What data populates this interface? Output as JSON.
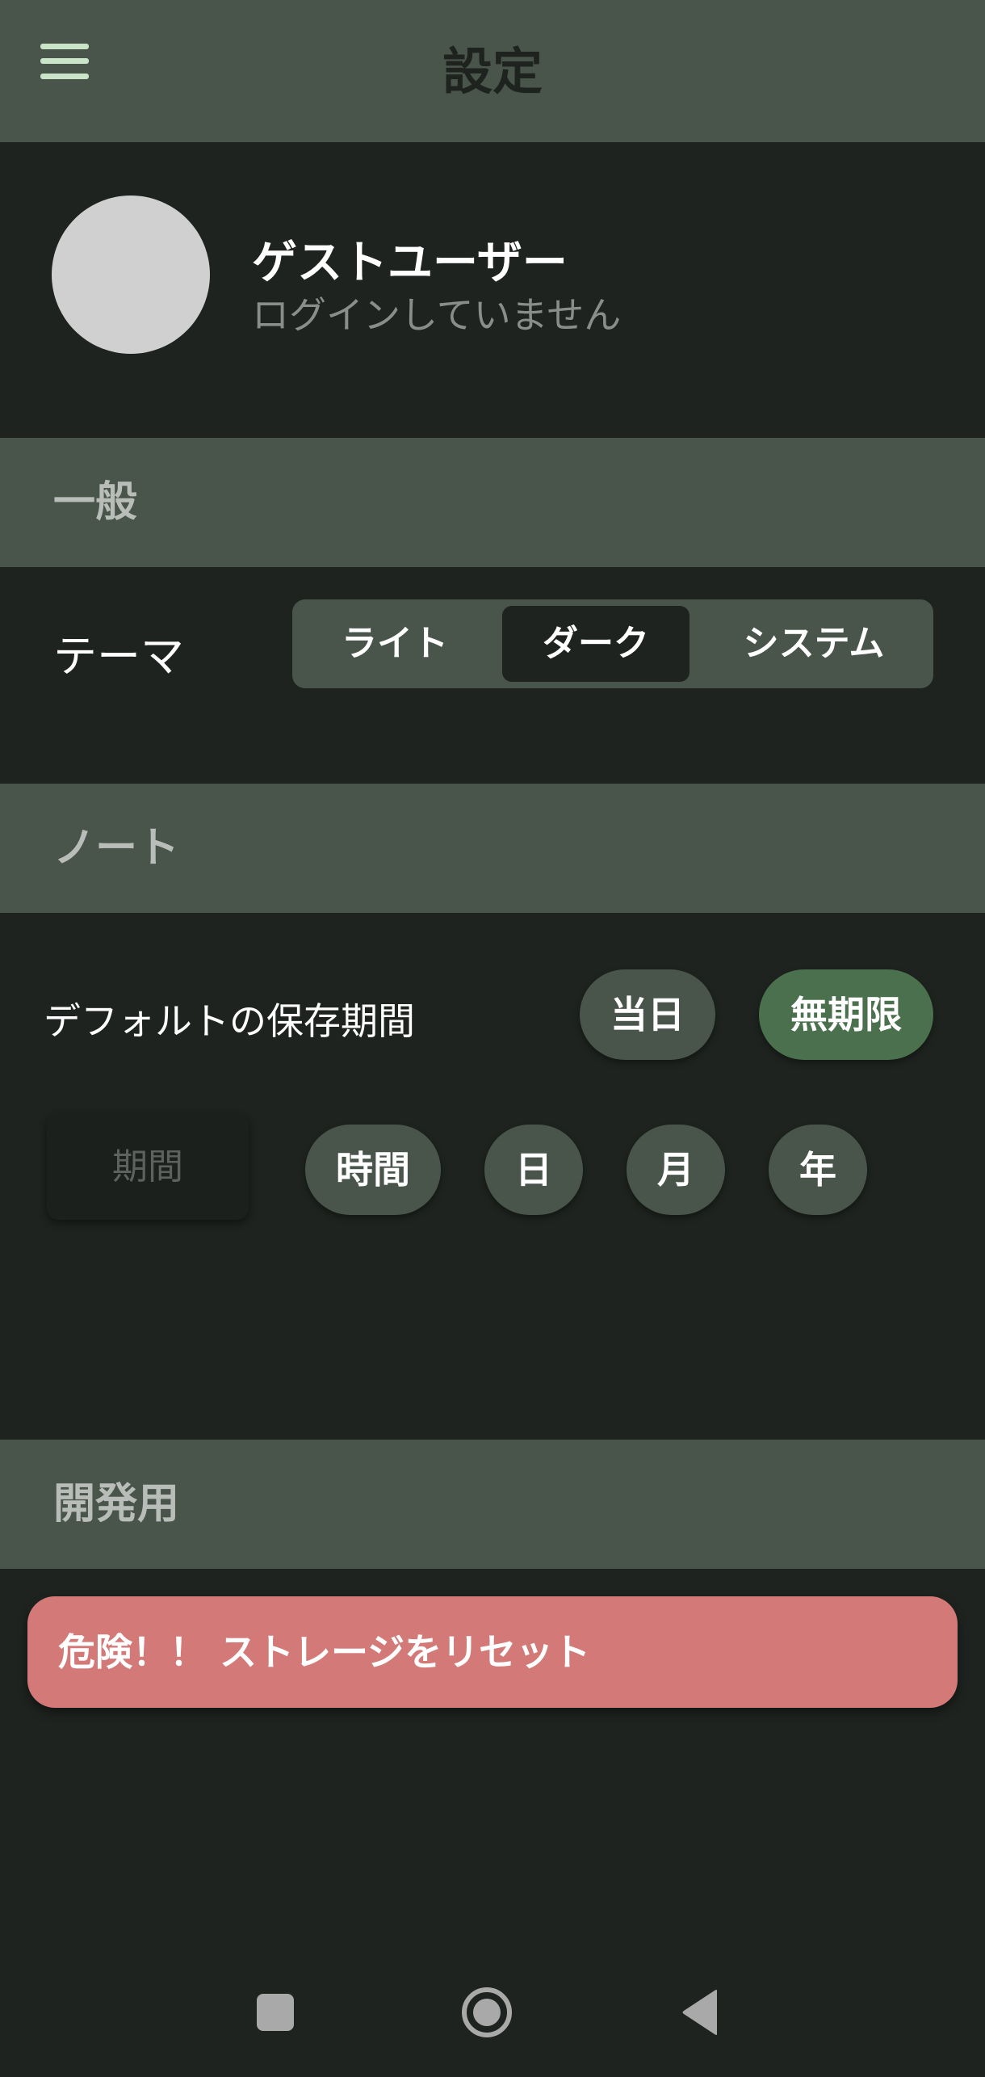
{
  "header": {
    "title": "設定",
    "menu_icon": "menu-icon"
  },
  "profile": {
    "name": "ゲストユーザー",
    "status": "ログインしていません"
  },
  "sections": {
    "general": "一般",
    "notes": "ノート",
    "dev": "開発用"
  },
  "theme": {
    "label": "テーマ",
    "options": [
      "ライト",
      "ダーク",
      "システム"
    ],
    "selected": "ダーク"
  },
  "retention": {
    "label": "デフォルトの保存期間",
    "options": [
      "当日",
      "無期限"
    ],
    "selected": "無期限",
    "period_placeholder": "期間",
    "units": [
      "時間",
      "日",
      "月",
      "年"
    ]
  },
  "danger": {
    "reset_label": "危険！！ ストレージをリセット"
  },
  "colors": {
    "appbar": "#49554b",
    "background": "#1e231f",
    "accent": "#4b704d",
    "danger": "#d37a78"
  },
  "nav": {
    "icons": [
      "recents-icon",
      "home-icon",
      "back-icon"
    ]
  }
}
